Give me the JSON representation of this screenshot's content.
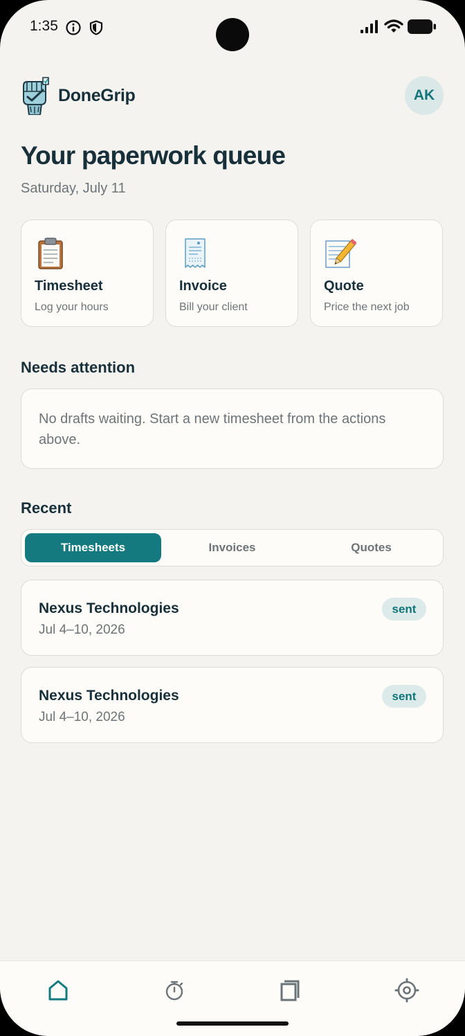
{
  "status_bar": {
    "time": "1:35",
    "icons": [
      "info-icon",
      "shield-icon",
      "cellular-signal-icon",
      "wifi-icon",
      "battery-icon"
    ]
  },
  "header": {
    "app_name": "DoneGrip",
    "logo_icon": "fist-clipboard-logo",
    "avatar_initials": "AK"
  },
  "page": {
    "title": "Your paperwork queue",
    "date": "Saturday, July 11"
  },
  "actions": [
    {
      "icon": "clipboard-icon",
      "title": "Timesheet",
      "subtitle": "Log your hours"
    },
    {
      "icon": "receipt-icon",
      "title": "Invoice",
      "subtitle": "Bill your client"
    },
    {
      "icon": "memo-pencil-icon",
      "title": "Quote",
      "subtitle": "Price the next job"
    }
  ],
  "needs_attention": {
    "title": "Needs attention",
    "message": "No drafts waiting. Start a new timesheet from the actions above."
  },
  "recent": {
    "title": "Recent",
    "tabs": [
      {
        "label": "Timesheets",
        "active": true
      },
      {
        "label": "Invoices",
        "active": false
      },
      {
        "label": "Quotes",
        "active": false
      }
    ],
    "items": [
      {
        "client": "Nexus Technologies",
        "period": "Jul 4–10, 2026",
        "status": "sent"
      },
      {
        "client": "Nexus Technologies",
        "period": "Jul 4–10, 2026",
        "status": "sent"
      }
    ]
  },
  "bottom_nav": {
    "items": [
      {
        "icon": "home-icon",
        "active": true
      },
      {
        "icon": "stopwatch-icon",
        "active": false
      },
      {
        "icon": "documents-icon",
        "active": false
      },
      {
        "icon": "settings-icon",
        "active": false
      }
    ]
  },
  "colors": {
    "accent": "#157a80",
    "background": "#f4f3ef",
    "card": "#fdfcf8",
    "text_primary": "#17303a",
    "text_secondary": "#6d7478",
    "badge_bg": "#dcebea"
  }
}
